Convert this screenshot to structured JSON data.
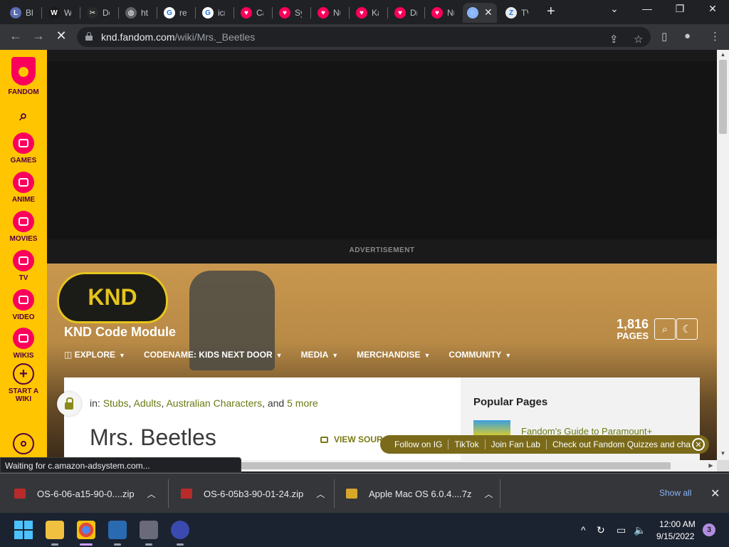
{
  "browser": {
    "tabs": [
      {
        "label": "Bla",
        "fav_color": "#5a6db0",
        "fav_glyph": "L"
      },
      {
        "label": "Wi",
        "fav_color": "#1a1a1a",
        "fav_glyph": "W"
      },
      {
        "label": "Do",
        "fav_color": "#2a2a2a",
        "fav_glyph": "✂"
      },
      {
        "label": "htt",
        "fav_color": "#5f6368",
        "fav_glyph": "◍"
      },
      {
        "label": "rec",
        "fav_color": "#ffffff",
        "fav_glyph": "G"
      },
      {
        "label": "icn",
        "fav_color": "#ffffff",
        "fav_glyph": "G"
      },
      {
        "label": "Ca",
        "fav_color": "#fa005a",
        "fav_glyph": "♥"
      },
      {
        "label": "Sy",
        "fav_color": "#fa005a",
        "fav_glyph": "♥"
      },
      {
        "label": "Nu",
        "fav_color": "#fa005a",
        "fav_glyph": "♥"
      },
      {
        "label": "Ka",
        "fav_color": "#fa005a",
        "fav_glyph": "♥"
      },
      {
        "label": "Dr",
        "fav_color": "#fa005a",
        "fav_glyph": "♥"
      },
      {
        "label": "Nu",
        "fav_color": "#fa005a",
        "fav_glyph": "♥"
      },
      {
        "label": "",
        "fav_color": "#8ab4f8",
        "fav_glyph": "◌"
      },
      {
        "label": "TV",
        "fav_color": "#e8eaed",
        "fav_glyph": "Z"
      }
    ],
    "url_host": "knd.fandom.com",
    "url_path": "/wiki/Mrs._Beetles",
    "status_text": "Waiting for c.amazon-adsystem.com..."
  },
  "rail": {
    "brand": "FANDOM",
    "items": [
      "GAMES",
      "ANIME",
      "MOVIES",
      "TV",
      "VIDEO",
      "WIKIS"
    ],
    "start_line1": "START A",
    "start_line2": "WIKI"
  },
  "page": {
    "ad_label": "ADVERTISEMENT",
    "logo_text": "KND",
    "wiki_name": "KND Code Module",
    "page_count": "1,816",
    "page_count_label": "PAGES",
    "nav": [
      {
        "label": "EXPLORE",
        "has_icon": true
      },
      {
        "label": "CODENAME: KIDS NEXT DOOR"
      },
      {
        "label": "MEDIA"
      },
      {
        "label": "MERCHANDISE"
      },
      {
        "label": "COMMUNITY"
      }
    ],
    "categories_prefix": "in:",
    "categories": [
      "Stubs",
      "Adults",
      "Australian Characters"
    ],
    "categories_and": "and",
    "categories_more": "5 more",
    "title": "Mrs. Beetles",
    "view_source": "VIEW SOUR",
    "popular_title": "Popular Pages",
    "popular_link": "Fandom's Guide to Paramount+",
    "social": [
      "Follow on IG",
      "TikTok",
      "Join Fan Lab",
      "Check out Fandom Quizzes and cha"
    ]
  },
  "downloads": {
    "items": [
      "OS-6-06-a15-90-0....zip",
      "OS-6-05b3-90-01-24.zip",
      "Apple Mac OS 6.0.4....7z"
    ],
    "show_all": "Show all"
  },
  "taskbar": {
    "time": "12:00 AM",
    "date": "9/15/2022",
    "notifications": "3"
  }
}
